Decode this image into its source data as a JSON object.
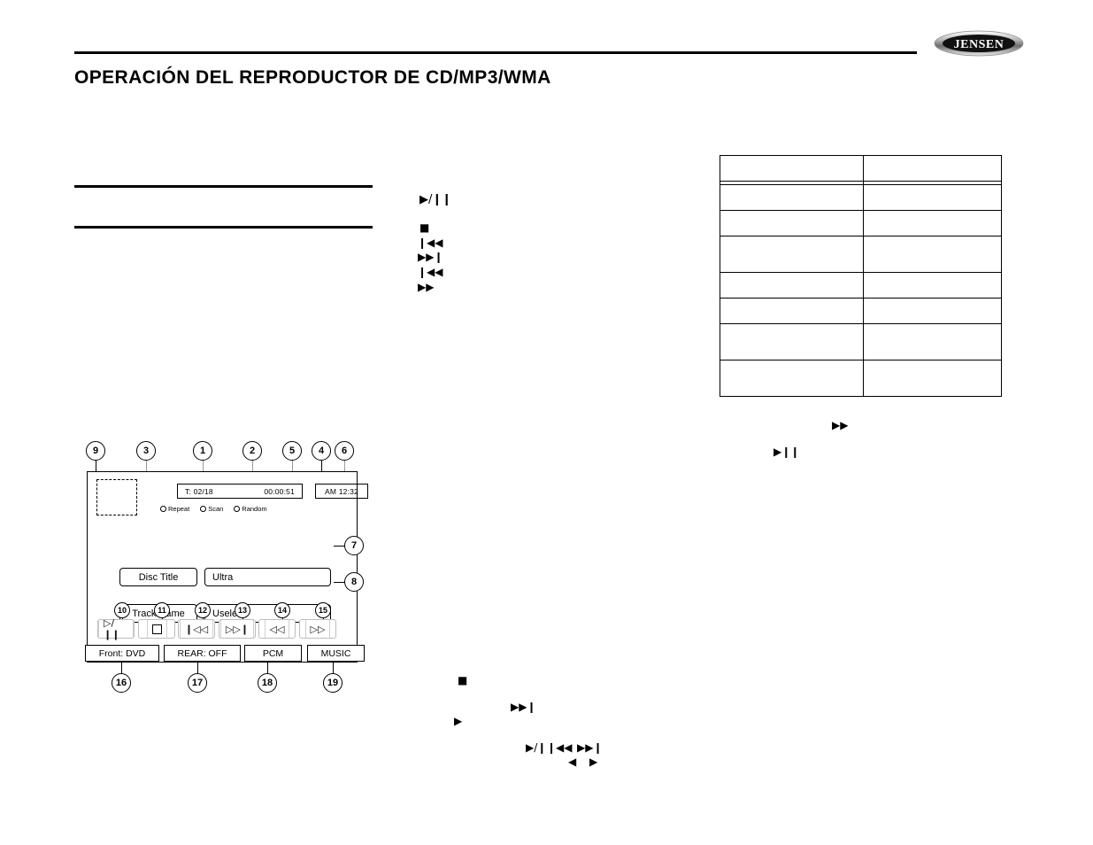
{
  "header": {
    "brand": "JENSEN",
    "title": "OPERACIÓN DEL REPRODUCTOR DE CD/MP3/WMA"
  },
  "middle_column_glyphs": [
    {
      "name": "play-pause-icon",
      "glyph": "▶/❙❙"
    },
    {
      "name": "stop-icon",
      "glyph": "■"
    },
    {
      "name": "previous-track-icon",
      "glyph": "❙◀◀"
    },
    {
      "name": "next-track-icon",
      "glyph": "▶▶❙"
    },
    {
      "name": "rewind-icon",
      "glyph": "❙◀◀"
    },
    {
      "name": "fast-forward-icon",
      "glyph": "▶▶"
    }
  ],
  "right_column_glyphs": [
    {
      "name": "fast-forward-icon",
      "glyph": "▶▶"
    },
    {
      "name": "play-pause-icon",
      "glyph": "▶❙❙"
    }
  ],
  "bottom_glyphs": [
    {
      "name": "stop-icon",
      "glyph": "■"
    },
    {
      "name": "next-track-icon",
      "glyph": "▶▶❙"
    },
    {
      "name": "play-icon",
      "glyph": "▶"
    },
    {
      "name": "play-pause-icon",
      "glyph": "▶/❙"
    },
    {
      "name": "previous-track-icon",
      "glyph": "❙◀◀"
    },
    {
      "name": "next-track-icon-2",
      "glyph": "▶▶❙"
    },
    {
      "name": "left-arrow-icon",
      "glyph": "◀"
    },
    {
      "name": "right-arrow-icon",
      "glyph": "▶"
    }
  ],
  "spec_table": {
    "rows": [
      {
        "col1": "",
        "col2": ""
      },
      {
        "col1": "",
        "col2": ""
      },
      {
        "col1": "",
        "col2": ""
      },
      {
        "col1": "",
        "col2": ""
      },
      {
        "col1": "",
        "col2": ""
      },
      {
        "col1": "",
        "col2": ""
      },
      {
        "col1": "",
        "col2": ""
      },
      {
        "col1": "",
        "col2": ""
      }
    ]
  },
  "diagram": {
    "info_bar": {
      "track": "T: 02/18",
      "time": "00:00:51"
    },
    "clock": "AM 12:32",
    "radios": [
      {
        "label": "Repeat"
      },
      {
        "label": "Scan"
      },
      {
        "label": "Random"
      }
    ],
    "fields": [
      {
        "label": "Disc Title",
        "value": "Ultra"
      },
      {
        "label": "Track Name",
        "value": "Useless"
      }
    ],
    "transport": [
      {
        "name": "play-pause-button",
        "glyph": "▷/❙❙"
      },
      {
        "name": "stop-button",
        "glyph": ""
      },
      {
        "name": "previous-track-button",
        "glyph": "❙◁◁"
      },
      {
        "name": "next-track-button",
        "glyph": "▷▷❙"
      },
      {
        "name": "rewind-button",
        "glyph": "◁◁"
      },
      {
        "name": "fast-forward-button",
        "glyph": "▷▷"
      }
    ],
    "status": [
      {
        "label": "Front: DVD"
      },
      {
        "label": "REAR: OFF"
      },
      {
        "label": "PCM"
      },
      {
        "label": "MUSIC"
      }
    ],
    "callouts_top": [
      {
        "num": "9"
      },
      {
        "num": "3"
      },
      {
        "num": "1"
      },
      {
        "num": "2"
      },
      {
        "num": "5"
      },
      {
        "num": "4"
      },
      {
        "num": "6"
      }
    ],
    "callouts_side": [
      {
        "num": "7"
      },
      {
        "num": "8"
      }
    ],
    "callouts_transport": [
      {
        "num": "10"
      },
      {
        "num": "11"
      },
      {
        "num": "12"
      },
      {
        "num": "13"
      },
      {
        "num": "14"
      },
      {
        "num": "15"
      }
    ],
    "callouts_bottom": [
      {
        "num": "16"
      },
      {
        "num": "17"
      },
      {
        "num": "18"
      },
      {
        "num": "19"
      }
    ]
  }
}
